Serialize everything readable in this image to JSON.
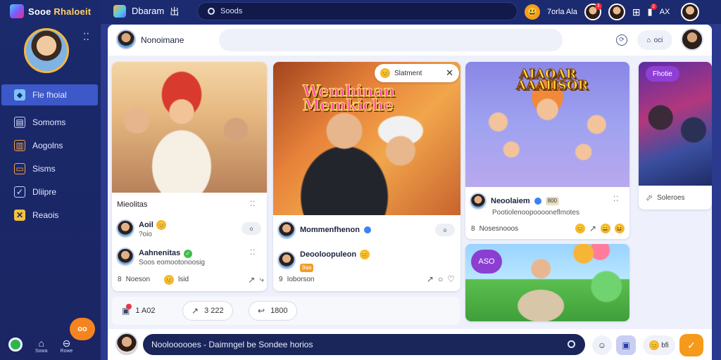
{
  "brand": {
    "name_part1": "Sooe",
    "name_part2": "Rhaloeit"
  },
  "sidebar": {
    "menu_icon": "dots-icon",
    "items": [
      {
        "label": "Fle fhoial",
        "icon": "tag-icon",
        "active": true
      },
      {
        "label": "Somoms",
        "icon": "calendar-icon"
      },
      {
        "label": "Aogolns",
        "icon": "chart-icon"
      },
      {
        "label": "Sisms",
        "icon": "folder-icon"
      },
      {
        "label": "Dliipre",
        "icon": "check-icon"
      },
      {
        "label": "Reaois",
        "icon": "star-icon"
      }
    ],
    "fab_label": "oo",
    "bottom": [
      {
        "label": ""
      },
      {
        "label": "Sowa"
      },
      {
        "label": "Rowe"
      }
    ]
  },
  "topbar": {
    "title": "Dbaram",
    "title_suffix": "出",
    "search_text": "Soods",
    "coin_label": "7orla Ala",
    "notif_count": "3",
    "alert_count": "2",
    "user_tag": "AX"
  },
  "panel": {
    "header": {
      "name": "Nonoimane",
      "pill_label": "oci"
    },
    "card1": {
      "section_title": "Mieolitas",
      "comments": [
        {
          "name": "Aoil",
          "emoji": "😊",
          "text": "?oio",
          "reply": "o"
        },
        {
          "name": "Aahnenitas",
          "badge": "✓",
          "text": "Soos eomootonoosig"
        }
      ],
      "footer_count": "8",
      "footer_text": "Noeson",
      "footer_emoji": "😊",
      "footer_mid": "lsid"
    },
    "card2": {
      "image_title_line1": "Wemhinan",
      "image_title_line2": "Memkiche",
      "pill_text": "Slatment",
      "comments": [
        {
          "name": "Mommenfhenon",
          "reply": "o"
        },
        {
          "name": "Deooloopuleon",
          "chip": "9aa"
        }
      ],
      "footer_count": "9",
      "footer_text": "Ioborson"
    },
    "card3": {
      "image_title_line1": "AIAOAR",
      "image_title_line2": "AAAIISOR",
      "author": "Neoolaiem",
      "author_chip": "800",
      "text": "Pootiolenoopooooneflmotes",
      "footer_count": "8",
      "footer_text": "Nosesnooos"
    },
    "card4": {
      "tag": "Fhotie",
      "label": "Soleroes"
    },
    "card5": {
      "tag": "ASO"
    },
    "actions": [
      {
        "icon": "clipboard-icon",
        "label": "1 A02"
      },
      {
        "icon": "share-icon",
        "label": "3 222"
      },
      {
        "icon": "reply-icon",
        "label": "1800"
      }
    ],
    "composer": {
      "input_text": "Nooloooooes - Daimngel be Sondee horios",
      "pill_label": "bfi"
    }
  }
}
